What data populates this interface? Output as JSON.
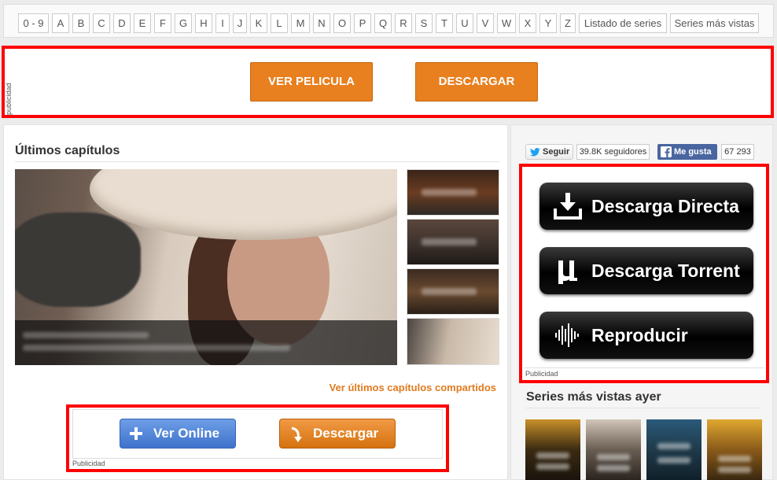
{
  "alphabet": [
    "0 - 9",
    "A",
    "B",
    "C",
    "D",
    "E",
    "F",
    "G",
    "H",
    "I",
    "J",
    "K",
    "L",
    "M",
    "N",
    "O",
    "P",
    "Q",
    "R",
    "S",
    "T",
    "U",
    "V",
    "W",
    "X",
    "Y",
    "Z"
  ],
  "nav_links": {
    "series_list": "Listado de series",
    "most_viewed": "Series más vistas"
  },
  "top_ad": {
    "label": "publicidad",
    "watch_movie": "VER PELICULA",
    "download": "DESCARGAR"
  },
  "latest": {
    "title": "Últimos capítulos",
    "more_link": "Ver últimos capítulos compartidos"
  },
  "bottom_ad": {
    "watch_online": "Ver Online",
    "download": "Descargar",
    "label": "Publicidad"
  },
  "social": {
    "follow": "Seguir",
    "followers": "39.8K seguidores",
    "like": "Me gusta",
    "like_count": "67 293"
  },
  "right_ad": {
    "direct_download": "Descarga Directa",
    "torrent_download": "Descarga Torrent",
    "play": "Reproducir",
    "label": "Publicidad"
  },
  "yesterday": {
    "title": "Series más vistas ayer"
  },
  "colors": {
    "accent_orange": "#e8801f",
    "ad_border": "#ff0000",
    "twitter_blue": "#1da1f2",
    "facebook_blue": "#4a66a0",
    "btn_blue": "#4f82d8"
  },
  "icons": {
    "twitter": "twitter-bird-icon",
    "facebook": "facebook-f-icon",
    "plus": "plus-icon",
    "arrow": "curved-arrow-icon",
    "download": "download-tray-icon",
    "torrent": "utorrent-icon",
    "audio": "audio-wave-icon"
  }
}
